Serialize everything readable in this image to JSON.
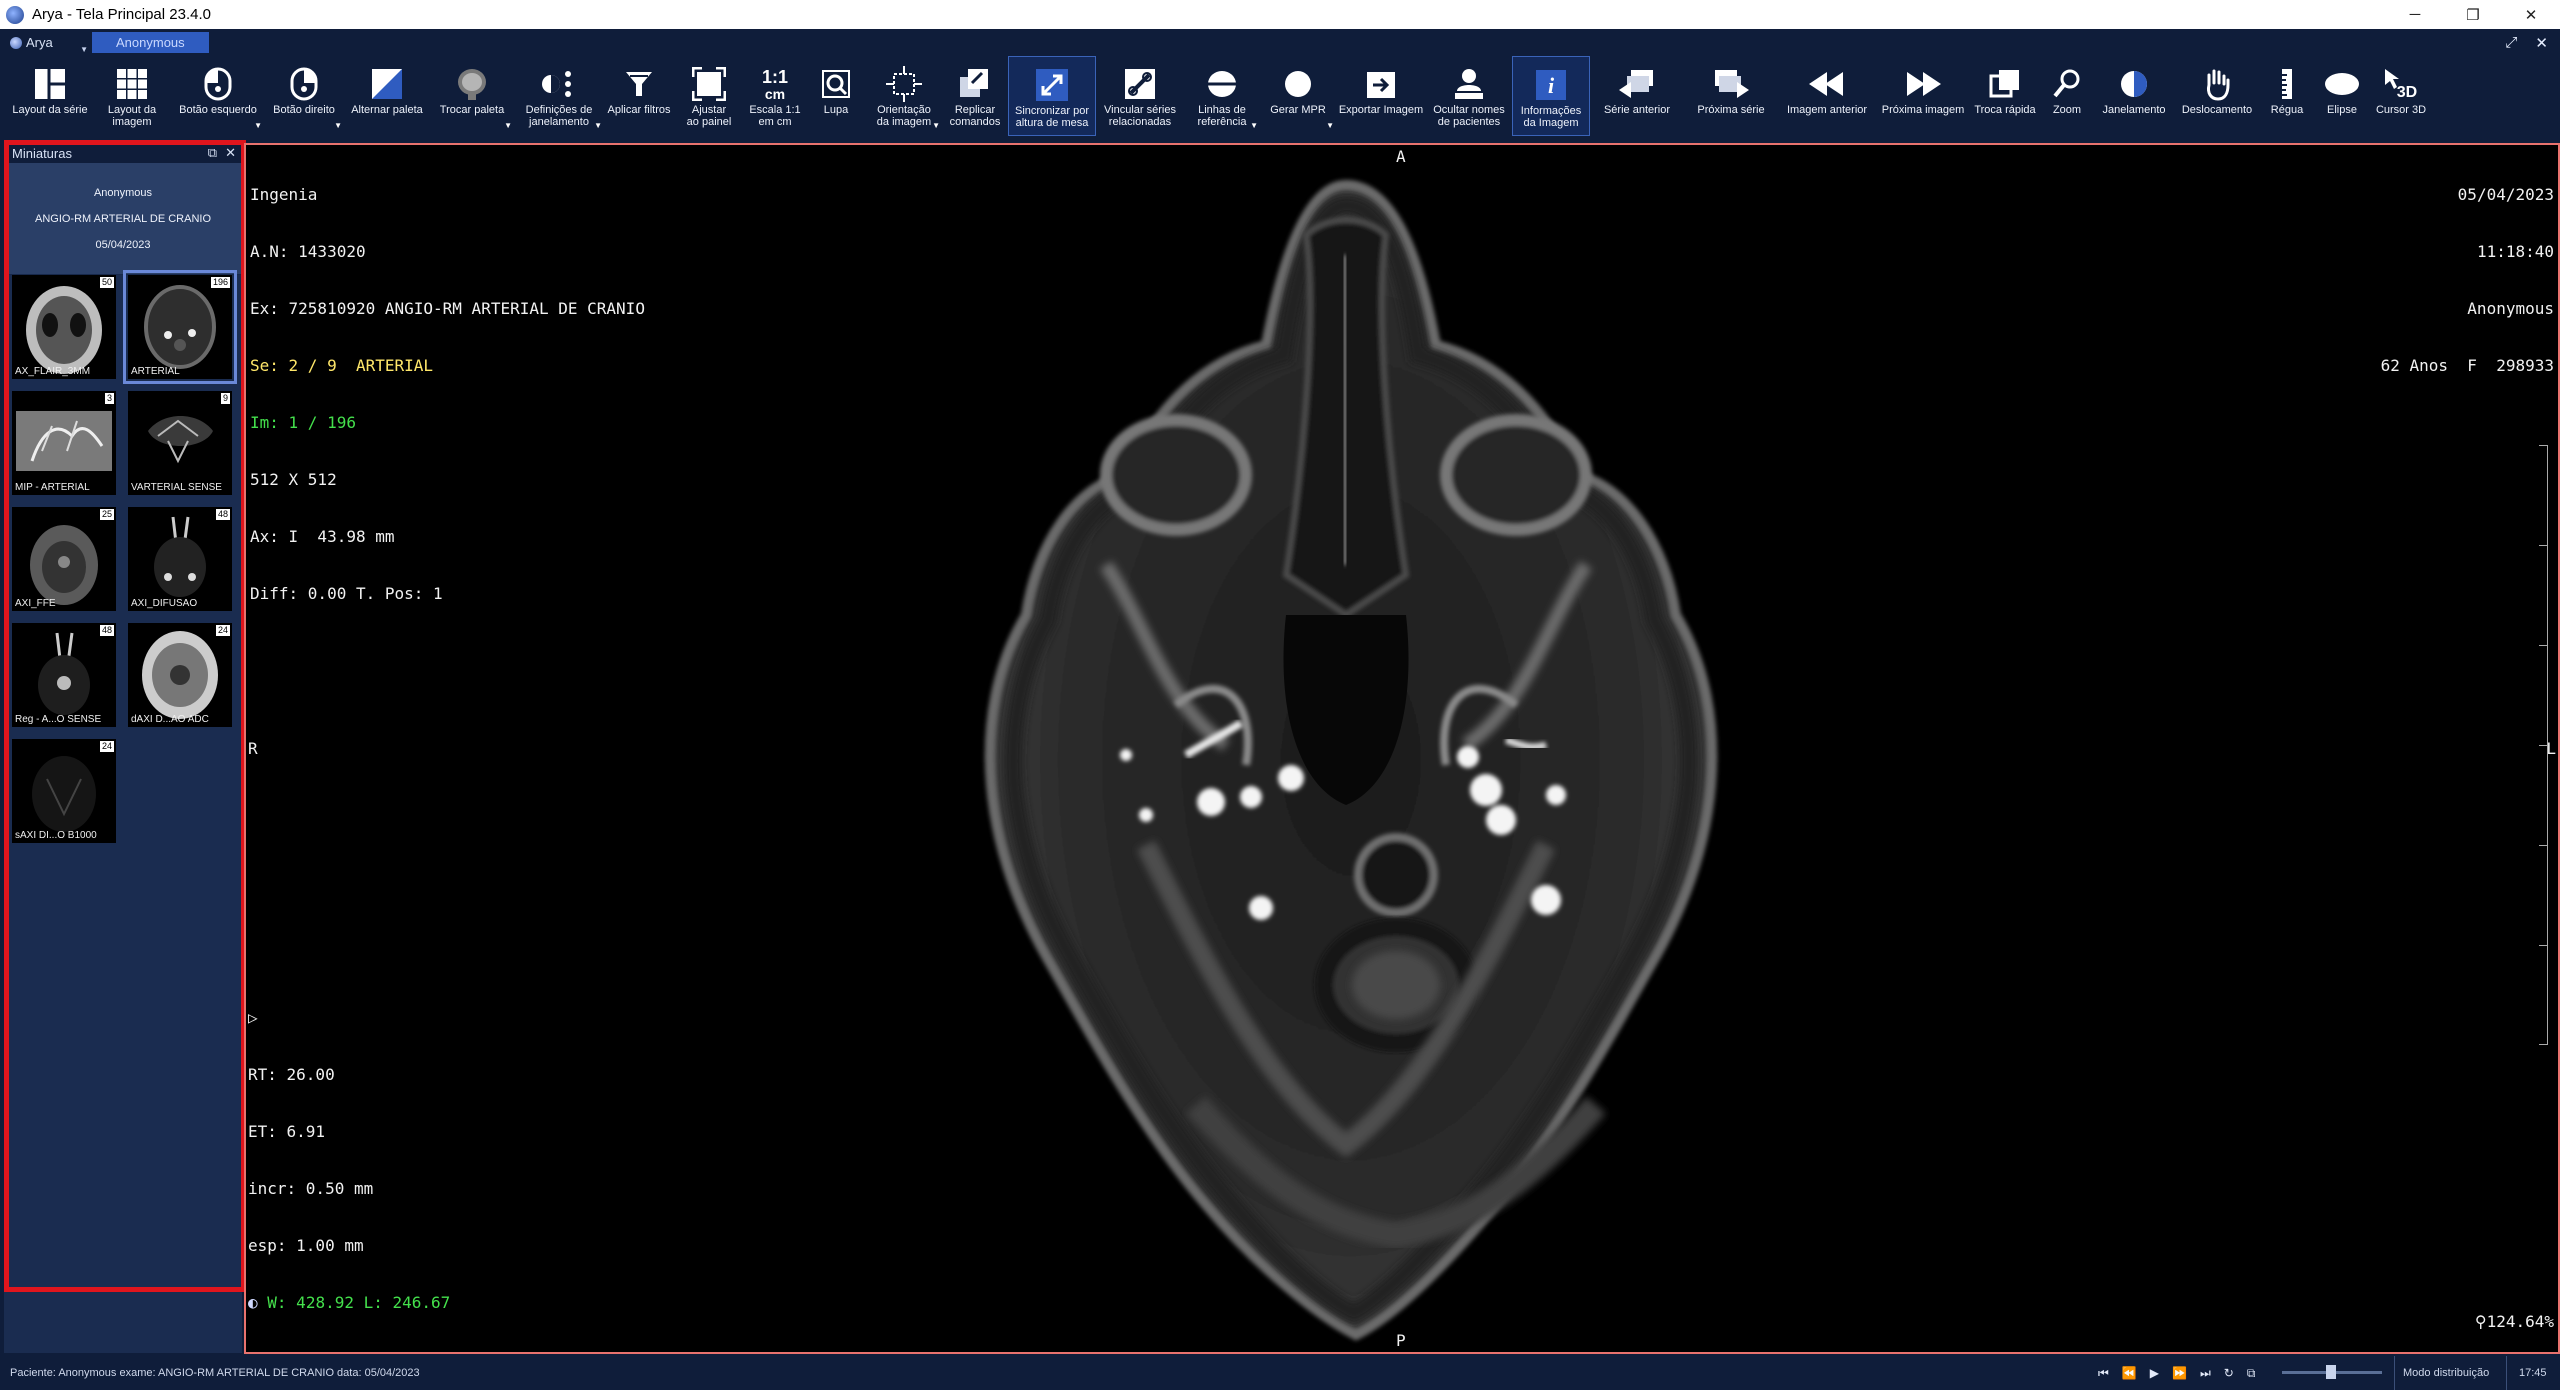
{
  "window": {
    "title": "Arya - Tela Principal 23.4.0",
    "controls": [
      "─",
      "❐",
      "✕"
    ]
  },
  "menu": {
    "app_label": "Arya",
    "patient_tab": "Anonymous"
  },
  "toolbar": {
    "items": [
      {
        "label": "Layout da série",
        "icon": "layout-series-icon"
      },
      {
        "label": "Layout da\nimagem",
        "icon": "layout-image-icon"
      },
      {
        "label": "Botão esquerdo",
        "icon": "mouse-left-icon"
      },
      {
        "label": "Botão direito",
        "icon": "mouse-right-icon"
      },
      {
        "label": "Alternar paleta",
        "icon": "palette-toggle-icon"
      },
      {
        "label": "Trocar paleta",
        "icon": "palette-swap-icon"
      },
      {
        "label": "Definições de\njanelamento",
        "icon": "window-settings-icon"
      },
      {
        "label": "Aplicar filtros",
        "icon": "filter-icon"
      },
      {
        "label": "Ajustar\nao painel",
        "icon": "fit-panel-icon"
      },
      {
        "label": "Escala 1:1\nem cm",
        "icon": "scale-1-1-icon"
      },
      {
        "label": "Lupa",
        "icon": "magnifier-icon"
      },
      {
        "label": "Orientação\nda imagem",
        "icon": "orientation-icon"
      },
      {
        "label": "Replicar\ncomandos",
        "icon": "replicate-icon"
      },
      {
        "label": "Sincronizar por\naltura de mesa",
        "icon": "sync-table-icon"
      },
      {
        "label": "Vincular séries\nrelacionadas",
        "icon": "link-series-icon"
      },
      {
        "label": "Linhas de\nreferência",
        "icon": "reference-lines-icon"
      },
      {
        "label": "Gerar MPR",
        "icon": "mpr-icon"
      },
      {
        "label": "Exportar Imagem",
        "icon": "export-icon"
      },
      {
        "label": "Ocultar nomes\nde pacientes",
        "icon": "hide-names-icon"
      },
      {
        "label": "Informações\nda Imagem",
        "icon": "image-info-icon"
      },
      {
        "label": "Série anterior",
        "icon": "prev-series-icon"
      },
      {
        "label": "Próxima série",
        "icon": "next-series-icon"
      },
      {
        "label": "Imagem anterior",
        "icon": "prev-image-icon"
      },
      {
        "label": "Próxima imagem",
        "icon": "next-image-icon"
      },
      {
        "label": "Troca rápida",
        "icon": "quick-swap-icon"
      },
      {
        "label": "Zoom",
        "icon": "zoom-icon"
      },
      {
        "label": "Janelamento",
        "icon": "windowing-icon"
      },
      {
        "label": "Deslocamento",
        "icon": "pan-hand-icon"
      },
      {
        "label": "Régua",
        "icon": "ruler-icon"
      },
      {
        "label": "Elipse",
        "icon": "ellipse-icon"
      },
      {
        "label": "Cursor 3D",
        "icon": "cursor-3d-icon"
      }
    ]
  },
  "thumbnails": {
    "title": "Miniaturas",
    "patient": "Anonymous",
    "study": "ANGIO-RM ARTERIAL DE CRANIO",
    "date": "05/04/2023",
    "series": [
      {
        "name": "AX_FLAIR_3MM",
        "count": "50"
      },
      {
        "name": "ARTERIAL",
        "count": "196"
      },
      {
        "name": "MIP - ARTERIAL",
        "count": "3"
      },
      {
        "name": "VARTERIAL SENSE",
        "count": "9"
      },
      {
        "name": "AXI_FFE",
        "count": "25"
      },
      {
        "name": "AXI_DIFUSAO",
        "count": "48"
      },
      {
        "name": "Reg - A...O SENSE",
        "count": "48"
      },
      {
        "name": "dAXI D...AO ADC",
        "count": "24"
      },
      {
        "name": "sAXI DI...O B1000",
        "count": "24"
      }
    ]
  },
  "viewer": {
    "top_left": {
      "institution": "Ingenia",
      "accession": "A.N: 1433020",
      "exam": "Ex: 725810920 ANGIO-RM ARTERIAL DE CRANIO",
      "series_prefix": "Se: 2 / 9",
      "series_name": "ARTERIAL",
      "image": "Im: 1 / 196",
      "matrix": "512 X 512",
      "axial": "Ax: I  43.98 mm",
      "diff": "Diff: 0.00 T. Pos: 1"
    },
    "top_right": {
      "date": "05/04/2023",
      "time": "11:18:40",
      "patient": "Anonymous",
      "demographics": "62 Anos  F  298933"
    },
    "bottom_left": {
      "rt": "RT: 26.00",
      "et": "ET: 6.91",
      "incr": "incr: 0.50 mm",
      "esp": "esp: 1.00 mm",
      "window": "W: 428.92 L: 246.67"
    },
    "bottom_right": {
      "zoom": "124.64%"
    },
    "orientation": {
      "top": "A",
      "bottom": "P",
      "left": "R",
      "right": "L"
    }
  },
  "statusbar": {
    "text": "Paciente: Anonymous exame: ANGIO-RM ARTERIAL DE CRANIO data: 05/04/2023",
    "mode": "Modo distribuição",
    "clock": "17:45"
  }
}
